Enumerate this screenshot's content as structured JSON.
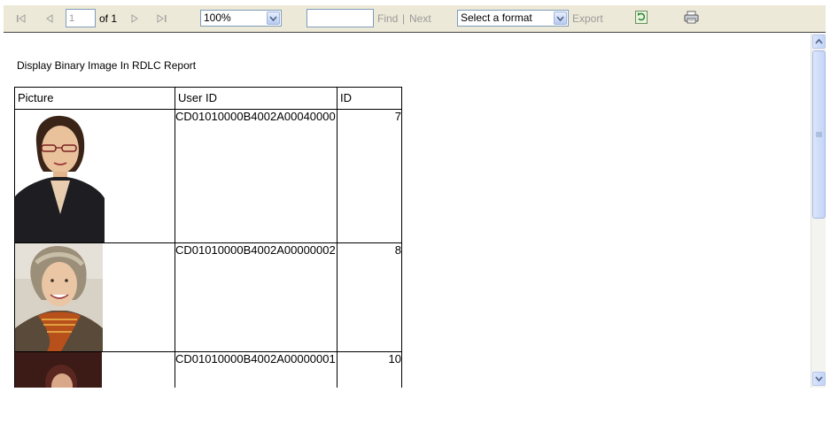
{
  "toolbar": {
    "page_number": "1",
    "page_of": "of 1",
    "zoom_value": "100%",
    "find_label": "Find",
    "find_separator": "|",
    "next_label": "Next",
    "format_value": "Select a format",
    "export_label": "Export"
  },
  "report": {
    "title": "Display Binary Image In RDLC Report",
    "columns": [
      "Picture",
      "User ID",
      "ID"
    ],
    "rows": [
      {
        "user_id": "CD01010000B4002A00040000",
        "id": "7"
      },
      {
        "user_id": "CD01010000B4002A00000002",
        "id": "8"
      },
      {
        "user_id": "CD01010000B4002A00000001",
        "id": "10"
      }
    ]
  }
}
